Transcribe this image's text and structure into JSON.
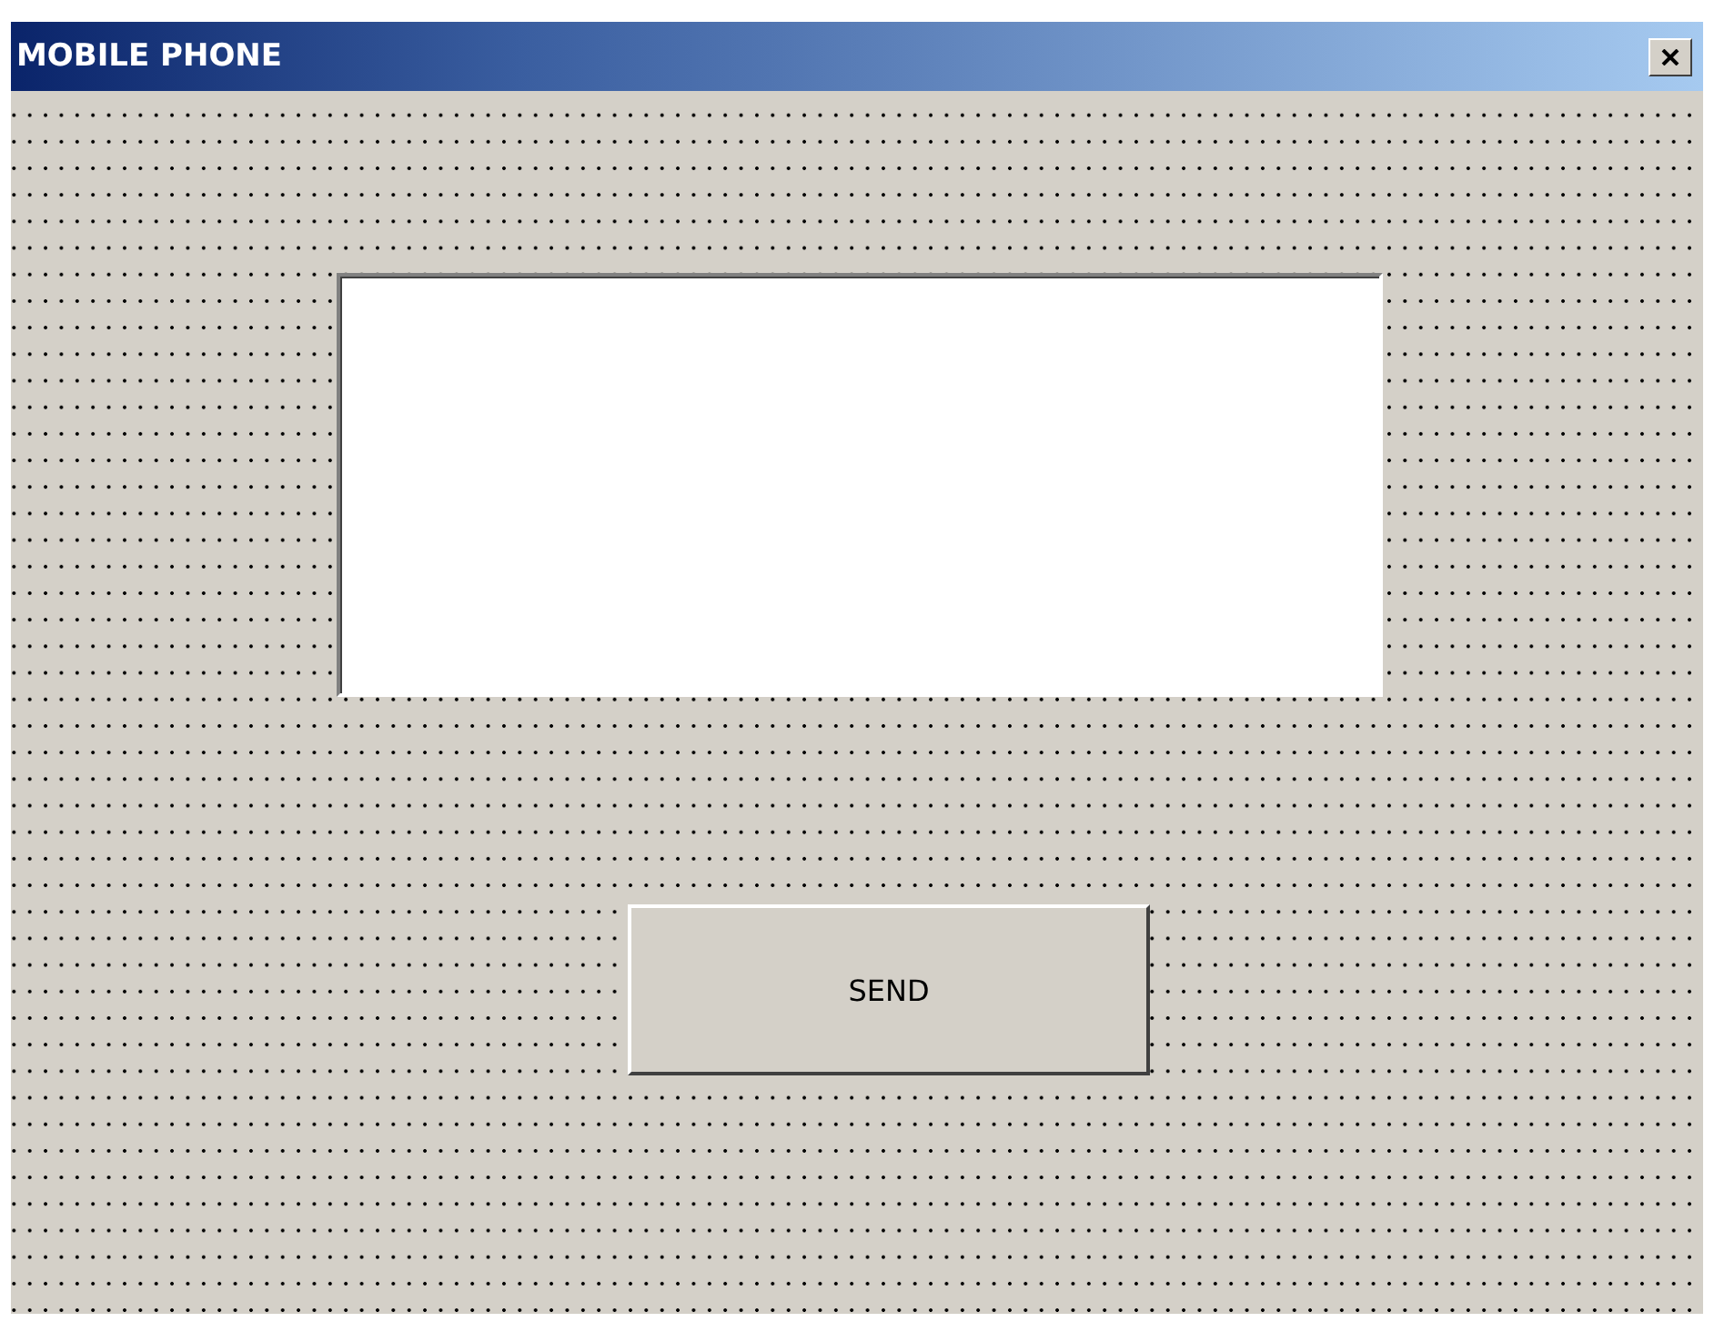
{
  "window": {
    "title": "MOBILE PHONE"
  },
  "controls": [
    {
      "kind": "textbox"
    },
    {
      "kind": "button",
      "label": "SEND"
    }
  ]
}
